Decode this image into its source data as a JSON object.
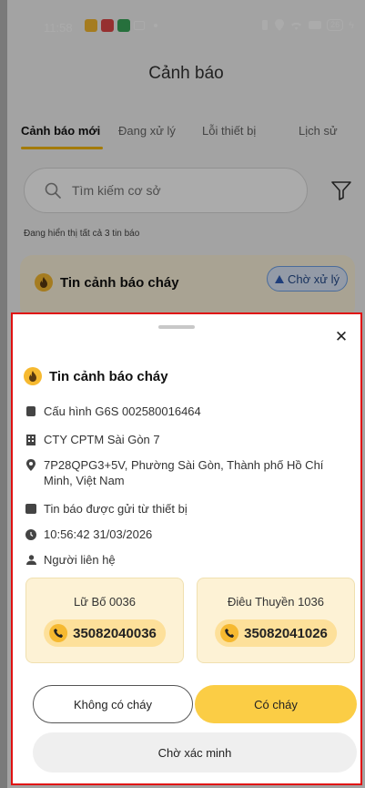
{
  "status_bar": {
    "time": "11:58",
    "battery": "26"
  },
  "header": {
    "title": "Cảnh báo"
  },
  "tabs": [
    {
      "label": "Cảnh báo mới",
      "active": true
    },
    {
      "label": "Đang xử lý",
      "active": false
    },
    {
      "label": "Lỗi thiết bị",
      "active": false
    },
    {
      "label": "Lịch sử",
      "active": false
    }
  ],
  "search": {
    "placeholder": "Tìm kiếm cơ sở"
  },
  "list": {
    "count_text": "Đang hiển thị tất cả 3 tin báo",
    "card": {
      "title": "Tin cảnh báo cháy",
      "status": "Chờ xử lý"
    }
  },
  "sheet": {
    "title": "Tin cảnh báo cháy",
    "device": "Cấu hình G6S 002580016464",
    "company": "CTY CPTM Sài Gòn 7",
    "address": "7P28QPG3+5V, Phường Sài Gòn, Thành phố Hồ Chí Minh, Việt Nam",
    "source": "Tin báo được gửi từ thiết bị",
    "timestamp": "10:56:42 31/03/2026",
    "contact_label": "Người liên hệ",
    "contacts": [
      {
        "name": "Lữ Bố 0036",
        "phone": "35082040036"
      },
      {
        "name": "Điêu Thuyền 1036",
        "phone": "35082041026"
      }
    ],
    "buttons": {
      "no_fire": "Không có cháy",
      "fire": "Có cháy",
      "verify": "Chờ xác minh"
    }
  },
  "colors": {
    "accent": "#fbcd45",
    "highlight_border": "#e01010",
    "badge_border": "#6fa1e8"
  }
}
